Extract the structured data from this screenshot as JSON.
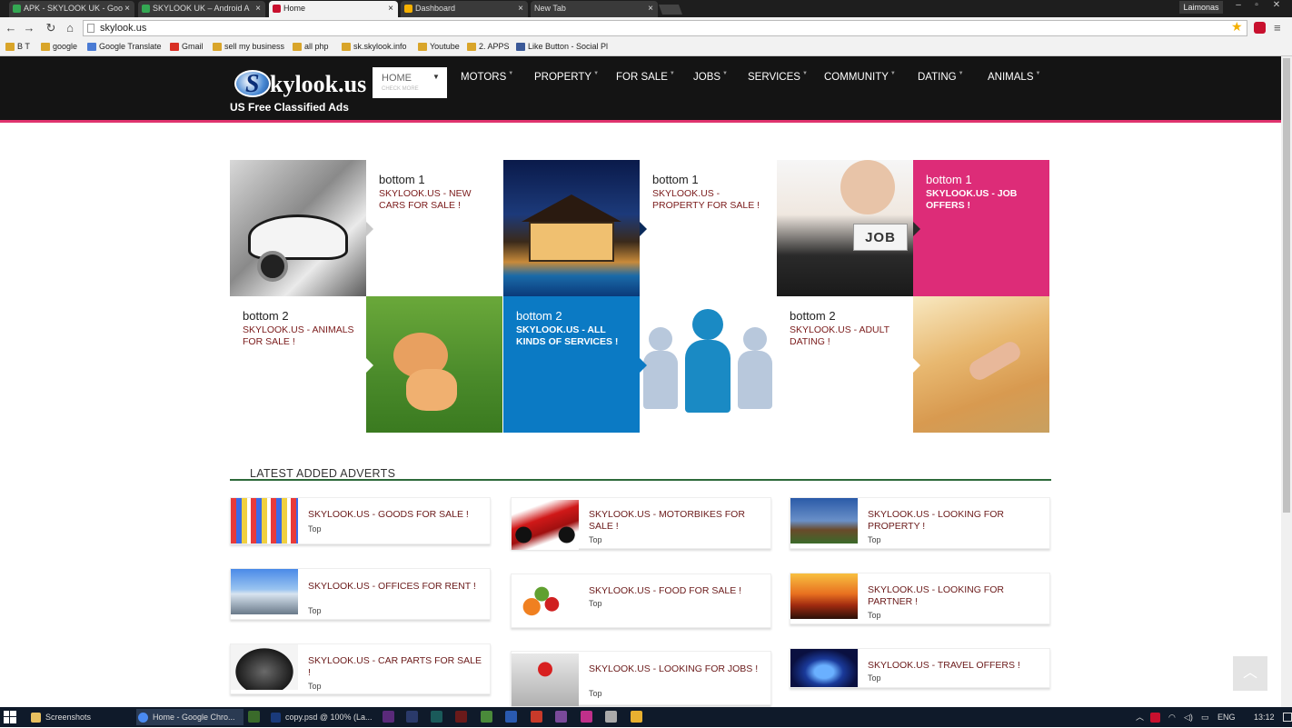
{
  "browser": {
    "tabs": [
      {
        "label": "APK - SKYLOOK UK - Goo",
        "color": "#34a853"
      },
      {
        "label": "SKYLOOK UK – Android A",
        "color": "#34a853"
      },
      {
        "label": "Home",
        "color": "#c8102e"
      },
      {
        "label": "Dashboard",
        "color": "#f5b000"
      },
      {
        "label": "New Tab",
        "color": ""
      }
    ],
    "close_glyph": "×",
    "profile": "Laimonas",
    "url": "skylook.us",
    "bookmarks": [
      "B T",
      "google",
      "Google Translate",
      "Gmail",
      "sell my business",
      "all php",
      "sk.skylook.info",
      "Youtube",
      "2. APPS",
      "Like Button - Social Pl"
    ]
  },
  "site": {
    "logo": {
      "letter": "S",
      "name": "kylook.us",
      "tagline": "US Free Classified Ads"
    },
    "nav": {
      "home": {
        "label": "HOME",
        "sub": "CHECK MORE"
      },
      "items": [
        "MOTORS",
        "PROPERTY",
        "FOR SALE",
        "JOBS",
        "SERVICES",
        "COMMUNITY",
        "DATING",
        "ANIMALS"
      ]
    },
    "tiles": [
      {
        "heading": "bottom 1",
        "text": "SKYLOOK.US - NEW CARS FOR SALE !"
      },
      {
        "heading": "bottom 1",
        "text": "SKYLOOK.US - PROPERTY FOR SALE !"
      },
      {
        "heading": "bottom 1",
        "text": "SKYLOOK.US - JOB OFFERS !"
      },
      {
        "heading": "bottom 2",
        "text": "SKYLOOK.US - ANIMALS FOR SALE !"
      },
      {
        "heading": "bottom 2",
        "text": "SKYLOOK.US - ALL KINDS OF SERVICES !"
      },
      {
        "heading": "bottom 2",
        "text": "SKYLOOK.US - ADULT DATING !"
      }
    ],
    "job_sign": "JOB",
    "latest": {
      "title": "LATEST ADDED ADVERTS",
      "adverts": [
        {
          "title": "SKYLOOK.US - GOODS FOR SALE !",
          "tag": "Top"
        },
        {
          "title": "SKYLOOK.US - OFFICES FOR RENT !",
          "tag": "Top"
        },
        {
          "title": "SKYLOOK.US - CAR PARTS FOR SALE !",
          "tag": "Top"
        },
        {
          "title": "SKYLOOK.US - MOTORBIKES FOR SALE !",
          "tag": "Top"
        },
        {
          "title": "SKYLOOK.US - FOOD FOR SALE !",
          "tag": "Top"
        },
        {
          "title": "SKYLOOK.US - LOOKING FOR JOBS !",
          "tag": "Top"
        },
        {
          "title": "SKYLOOK.US - LOOKING FOR PROPERTY !",
          "tag": "Top"
        },
        {
          "title": "SKYLOOK.US - LOOKING FOR PARTNER !",
          "tag": "Top"
        },
        {
          "title": "SKYLOOK.US - TRAVEL OFFERS !",
          "tag": "Top"
        }
      ]
    }
  },
  "taskbar": {
    "items": [
      "Screenshots",
      "Home - Google Chro...",
      "copy.psd @ 100% (La..."
    ],
    "lang": "ENG",
    "time": "13:12"
  },
  "colors": {
    "accent_pink": "#dd2c78",
    "accent_blue": "#0b7ac4",
    "header_bg": "#141414"
  }
}
